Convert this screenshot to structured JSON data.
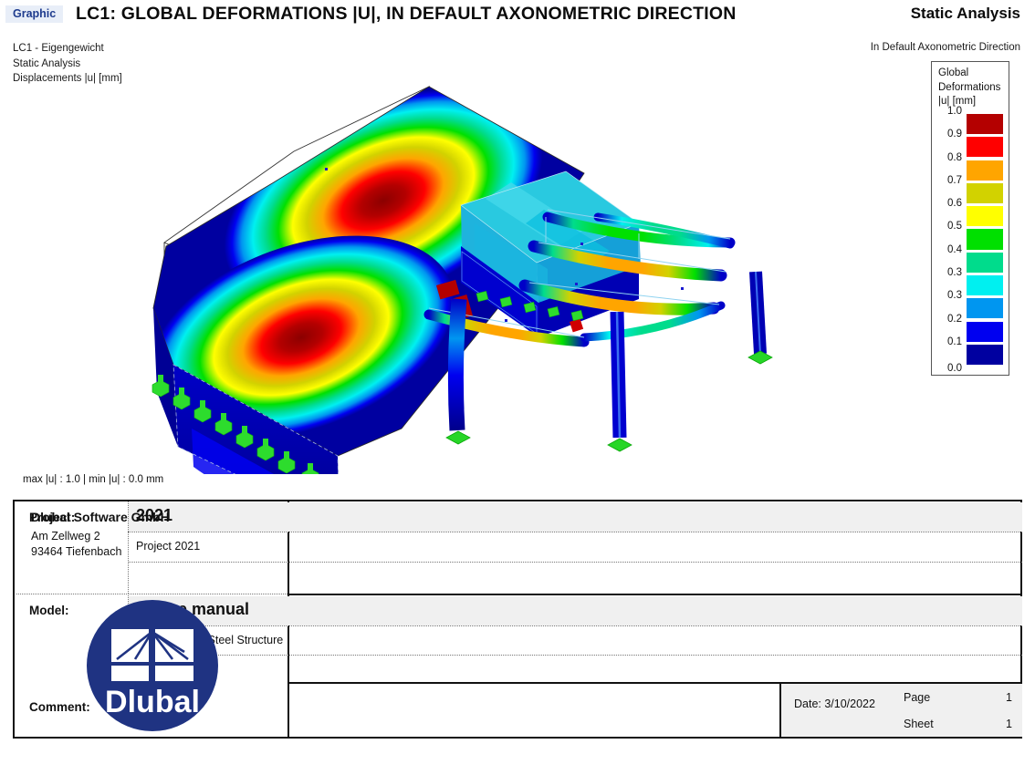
{
  "header": {
    "badge": "Graphic",
    "title": "LC1: GLOBAL DEFORMATIONS |U|, IN DEFAULT AXONOMETRIC DIRECTION",
    "right_title": "Static Analysis",
    "sub_line1": "LC1 - Eigengewicht",
    "sub_line2": "Static Analysis",
    "sub_line3": "Displacements |u| [mm]",
    "right_sub": "In Default Axonometric Direction"
  },
  "legend": {
    "title_line1": "Global",
    "title_line2": "Deformations",
    "title_line3": "|u| [mm]",
    "labels": [
      "1.0",
      "0.9",
      "0.8",
      "0.7",
      "0.6",
      "0.5",
      "0.4",
      "0.3",
      "0.3",
      "0.2",
      "0.1"
    ],
    "last_label": "0.0",
    "colors": [
      "#B40000",
      "#FF0000",
      "#FFA500",
      "#D2D200",
      "#FFFF00",
      "#00E000",
      "#00DC8C",
      "#00F0F0",
      "#0096F0",
      "#0000F0",
      "#0000A0"
    ]
  },
  "chart_data": {
    "type": "heatmap",
    "title": "Global Deformations |u| [mm]",
    "subtitle": "LC1 - Eigengewicht, Static Analysis",
    "colorbar_label": "|u| [mm]",
    "colorbar_ticks": [
      1.0,
      0.9,
      0.8,
      0.7,
      0.6,
      0.5,
      0.4,
      0.3,
      0.3,
      0.2,
      0.1,
      0.0
    ],
    "colorbar_colors": [
      "#B40000",
      "#FF0000",
      "#FFA500",
      "#D2D200",
      "#FFFF00",
      "#00E000",
      "#00DC8C",
      "#00F0F0",
      "#0096F0",
      "#0000F0",
      "#0000A0"
    ],
    "value_range": [
      0.0,
      1.0
    ],
    "units": "mm",
    "max_value": 1.0,
    "min_value": 0.0,
    "view": "Default Axonometric Direction",
    "annotations": [
      "max |u| : 1.0 | min |u| : 0.0 mm"
    ]
  },
  "status": {
    "minmax": "max |u| : 1.0 | min |u| : 0.0 mm"
  },
  "titleblock": {
    "company": "Dlubal Software GmbH",
    "address_line1": "Am Zellweg 2",
    "address_line2": "93464 Tiefenbach",
    "logo_text": "Dlubal",
    "project_label": "Project:",
    "project_name": "2021",
    "project_desc": "Project 2021",
    "model_label": "Model:",
    "model_name": "Online manual",
    "model_desc": "Concrete and Steel Structure",
    "comment_label": "Comment:",
    "date": "Date: 3/10/2022",
    "page_label": "Page",
    "page_value": "1",
    "sheet_label": "Sheet",
    "sheet_value": "1"
  },
  "colors": {
    "brand_navy": "#1F3382",
    "badge_blue": "#1f3c8e",
    "shade": "#F0F0F0"
  }
}
